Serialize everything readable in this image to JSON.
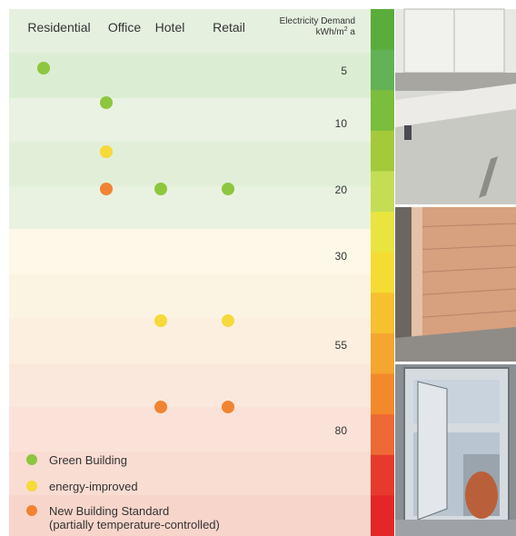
{
  "chart_data": {
    "type": "scatter",
    "categories": [
      "Residential",
      "Office",
      "Hotel",
      "Retail"
    ],
    "y_axis_title_line1": "Electricity Demand",
    "y_axis_unit_prefix": "kWh/m",
    "y_axis_unit_sup": "2",
    "y_axis_unit_suffix": " a",
    "y_ticks": [
      "5",
      "10",
      "20",
      "30",
      "55",
      "80"
    ],
    "series": [
      {
        "name": "Green Building",
        "color": "#8dc63f",
        "points": [
          [
            "Residential",
            5
          ],
          [
            "Office",
            10
          ],
          [
            "Hotel",
            20
          ],
          [
            "Retail",
            20
          ]
        ]
      },
      {
        "name": "energy-improved",
        "color": "#f6d93a",
        "points": [
          [
            "Office",
            15
          ],
          [
            "Hotel",
            50
          ],
          [
            "Retail",
            50
          ]
        ]
      },
      {
        "name": "New Building Standard",
        "name_line2": "(partially temperature-controlled)",
        "color": "#f08432",
        "points": [
          [
            "Office",
            20
          ],
          [
            "Hotel",
            70
          ],
          [
            "Retail",
            70
          ]
        ]
      }
    ],
    "color_scale": [
      "#5aac3c",
      "#63b255",
      "#7bbd3c",
      "#a4c93b",
      "#c5dc55",
      "#e9e43f",
      "#f4dc34",
      "#f6c02e",
      "#f4a630",
      "#f28a2c",
      "#ee6935",
      "#e63a2d",
      "#e42629"
    ],
    "background_bands": [
      "#e6f0df",
      "#dbeed3",
      "#eaf2e3",
      "#e2efd8",
      "#e9f2e0",
      "#fdf8e7",
      "#fcf4e2",
      "#fcefdf",
      "#fbe8dc",
      "#fbe2d9",
      "#f9dcd2",
      "#f8d5cb"
    ]
  }
}
